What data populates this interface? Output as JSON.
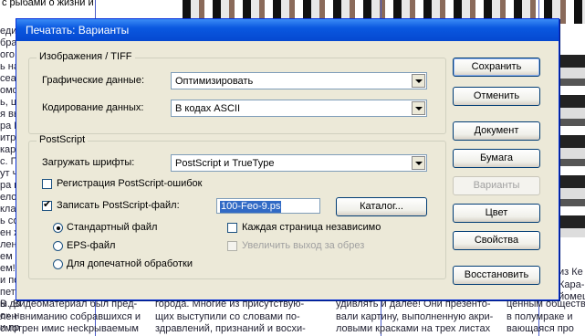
{
  "dialog": {
    "title": "Печатать: Варианты",
    "images_group": {
      "title": "Изображения / TIFF",
      "graphics_label": "Графические данные:",
      "graphics_value": "Оптимизировать",
      "encoding_label": "Кодирование данных:",
      "encoding_value": "В кодах ASCII"
    },
    "postscript_group": {
      "title": "PostScript",
      "fonts_label": "Загружать шрифты:",
      "fonts_value": "PostScript и TrueType",
      "register_errors_label": "Регистрация PostScript-ошибок",
      "register_errors_checked": false,
      "write_file_label": "Записать PostScript-файл:",
      "write_file_checked": true,
      "file_name": "100-Feo-9.ps",
      "catalog_button": "Каталог...",
      "radio_standard": "Стандартный файл",
      "radio_eps": "EPS-файл",
      "radio_prepress": "Для допечатной обработки",
      "selected_radio": "standard",
      "each_page_label": "Каждая страница независимо",
      "each_page_checked": false,
      "bleed_label": "Увеличить выход за обрез",
      "bleed_checked": false,
      "bleed_enabled": false
    },
    "buttons": {
      "save": "Сохранить",
      "cancel": "Отменить",
      "document": "Документ",
      "paper": "Бумага",
      "options": "Варианты",
      "color": "Цвет",
      "properties": "Свойства",
      "restore": "Восстановить"
    }
  },
  "background": {
    "top_text": "с рыбами о жизни и",
    "left_fragments": [
      "един",
      "браз",
      "ого",
      "ь на",
      "сеа",
      "омф",
      "ь, цит",
      "я вы",
      "ра Ш",
      "итра",
      "кар",
      "с. П",
      "ут ч",
      "ра в",
      "елов",
      "клад",
      "ь со",
      "ен ж",
      "ленн",
      "ем б",
      "ем!",
      "и по",
      "петр",
      "В до",
      "о» н",
      "и пр"
    ],
    "bottom_columns": [
      [
        "ы. Видеоматериал был пред-",
        "лен вниманию собравшихся и",
        "смотрен имис неckрываемым"
      ],
      [
        "города. Многие из присутствую-",
        "щих выступили со словами по-",
        "здравлений, признаний и восхи-"
      ],
      [
        "удивлять и далее! Они презенто-",
        "вали картину, выполненную акри-",
        "ловыми красками на трех листах"
      ],
      [
        "ценным обществен",
        "в полумраке и",
        "вающаяся про"
      ]
    ],
    "right_fragments": [
      "из Ке",
      "Кара-",
      "йомещ"
    ]
  }
}
